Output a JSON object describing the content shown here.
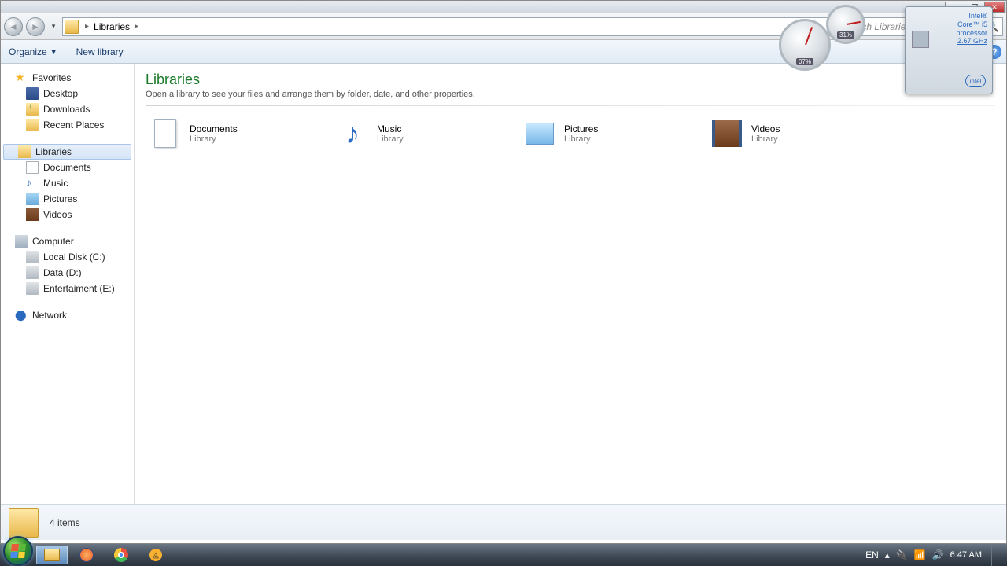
{
  "titlebar": {
    "min": "—",
    "max": "❐",
    "close": "✕"
  },
  "nav": {
    "crumb_root": "Libraries",
    "search_placeholder": "Search Libraries"
  },
  "toolbar": {
    "organize": "Organize",
    "newlib": "New library"
  },
  "sidebar": {
    "favorites": "Favorites",
    "fav_items": [
      "Desktop",
      "Downloads",
      "Recent Places"
    ],
    "libraries": "Libraries",
    "lib_items": [
      "Documents",
      "Music",
      "Pictures",
      "Videos"
    ],
    "computer": "Computer",
    "comp_items": [
      "Local Disk (C:)",
      "Data (D:)",
      "Entertaiment (E:)"
    ],
    "network": "Network"
  },
  "main": {
    "heading": "Libraries",
    "subtitle": "Open a library to see your files and arrange them by folder, date, and other properties.",
    "items": [
      {
        "name": "Documents",
        "sub": "Library"
      },
      {
        "name": "Music",
        "sub": "Library"
      },
      {
        "name": "Pictures",
        "sub": "Library"
      },
      {
        "name": "Videos",
        "sub": "Library"
      }
    ]
  },
  "statusbar": {
    "count": "4 items"
  },
  "gadgets": {
    "cpu_pct": "07%",
    "ram_pct": "31%",
    "intel_line1": "Intel®",
    "intel_line2": "Core™ i5",
    "intel_line3": "processor",
    "intel_ghz": "2.67 GHz",
    "intel_logo": "intel"
  },
  "tray": {
    "lang": "EN",
    "clock": "6:47 AM"
  }
}
